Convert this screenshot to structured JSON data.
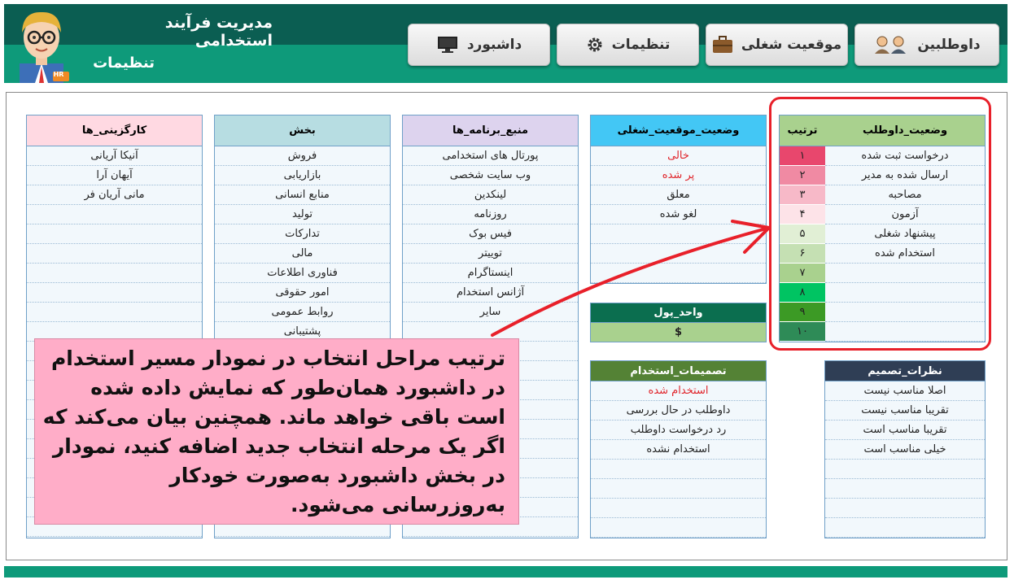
{
  "header": {
    "app_title": "مدیریت فرآیند استخدامی",
    "page_title": "تنظیمات",
    "avatar_badge": "HR"
  },
  "nav": {
    "candidates": "داوطلبین",
    "job_position": "موقعیت شغلی",
    "settings": "تنظیمات",
    "dashboard": "داشبورد"
  },
  "tables": {
    "hiring_firms": {
      "title": "کارگزینی_ها",
      "header_color": "#ffd9e2",
      "rows": [
        "آنیکا آریانی",
        "آیهان آرا",
        "مانی آریان فر",
        "",
        "",
        "",
        "",
        "",
        "",
        "",
        "",
        "",
        "",
        "",
        "",
        "",
        "",
        "",
        "",
        ""
      ]
    },
    "departments": {
      "title": "بخش",
      "header_color": "#b7dde2",
      "rows": [
        "فروش",
        "بازاریابی",
        "منابع انسانی",
        "تولید",
        "تدارکات",
        "مالی",
        "فناوری اطلاعات",
        "امور حقوقی",
        "روابط عمومی",
        "پشتیبانی",
        "",
        "",
        "",
        "",
        "",
        "",
        "",
        "",
        "",
        ""
      ]
    },
    "sources": {
      "title": "منبع_برنامه_ها",
      "header_color": "#ddd3ee",
      "rows": [
        "پورتال های استخدامی",
        "وب سایت شخصی",
        "لینکدین",
        "روزنامه",
        "فیس بوک",
        "توییتر",
        "اینستاگرام",
        "آژانس استخدام",
        "سایر",
        "",
        "",
        "",
        "",
        "",
        "",
        "",
        "",
        "",
        "",
        ""
      ]
    },
    "job_status": {
      "title": "وضعیت_موقعیت_شغلی",
      "header_color": "#43c7f5",
      "rows": [
        "خالی",
        "پر شده",
        "معلق",
        "لغو شده",
        "",
        "",
        ""
      ],
      "red_rows": [
        0,
        1
      ]
    },
    "currency": {
      "title": "واحد_پول",
      "header_color": "#0b6e4f",
      "value": "$",
      "value_color": "#a9d18e"
    },
    "hiring_decisions": {
      "title": "تصمیمات_استخدام",
      "header_color": "#548235",
      "rows": [
        "استخدام شده",
        "داوطلب در حال بررسی",
        "رد درخواست داوطلب",
        "استخدام نشده",
        "",
        "",
        "",
        ""
      ],
      "red_rows": [
        0
      ]
    },
    "decision_feedback": {
      "title": "نظرات_تصمیم",
      "header_color": "#2f3e55",
      "rows": [
        "اصلا مناسب نیست",
        "تقریبا مناسب نیست",
        "تقریبا مناسب است",
        "خیلی مناسب است",
        "",
        "",
        "",
        ""
      ]
    },
    "candidate_status": {
      "title": "وضعیت_داوطلب",
      "order_title": "ترتیب",
      "rows": [
        "درخواست ثبت شده",
        "ارسال شده به مدیر",
        "مصاحبه",
        "آزمون",
        "پیشنهاد شغلی",
        "استخدام شده",
        "",
        "",
        "",
        ""
      ],
      "order": [
        "۱",
        "۲",
        "۳",
        "۴",
        "۵",
        "۶",
        "۷",
        "۸",
        "۹",
        "۱۰"
      ],
      "order_colors": [
        "#e8476d",
        "#f08aa3",
        "#f7b9c8",
        "#fde3e8",
        "#e1efd5",
        "#c5e0b3",
        "#a9d18e",
        "#00c462",
        "#3c9a25",
        "#2e8b57"
      ]
    }
  },
  "callout": {
    "text": "ترتیب مراحل انتخاب در نمودار مسیر استخدام در داشبورد همان‌طور که نمایش داده شده است باقی خواهد ماند. همچنین بیان می‌کند که اگر یک مرحله انتخاب جدید اضافه کنید، نمودار در بخش داشبورد به‌صورت خودکار به‌روزرسانی می‌شود."
  },
  "colors": {
    "header_dark": "#0b5e52",
    "header_teal": "#0e9a7a",
    "annotation_red": "#e8202a",
    "callout_pink": "#ffadc8"
  },
  "icons": {
    "candidates": "people-icon",
    "job_position": "briefcase-icon",
    "settings": "gear-icon",
    "dashboard": "monitor-icon"
  }
}
